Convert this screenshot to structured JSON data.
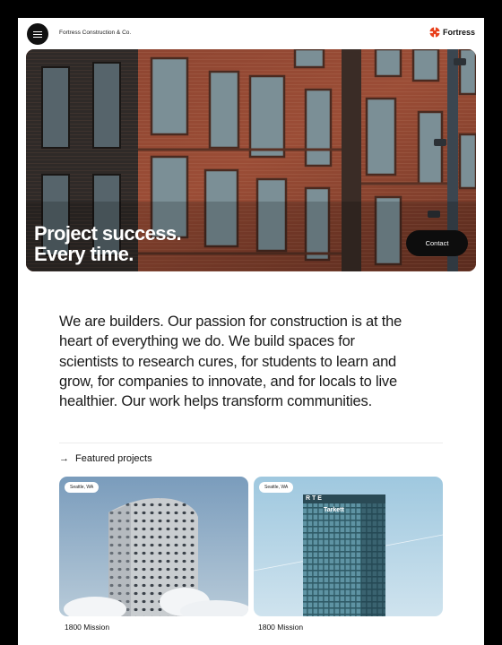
{
  "header": {
    "company_name": "Fortress Construction & Co.",
    "logo_text": "Fortress",
    "accent_color": "#e8401c",
    "menu_icon": "hamburger-menu-icon"
  },
  "hero": {
    "title_line1": "Project success.",
    "title_line2": "Every time.",
    "contact_label": "Contact"
  },
  "intro": {
    "text": "We are builders. Our passion for construction is at the heart of everything we do. We build spaces for scientists to research cures, for students to learn and grow, for companies to innovate, and for locals to live healthier. Our work helps transform communities."
  },
  "featured": {
    "label": "Featured projects",
    "arrow_icon": "arrow-right-icon",
    "projects": [
      {
        "location": "Seattle, WA",
        "title": "1800 Mission"
      },
      {
        "location": "Seattle, WA",
        "title": "1800 Mission"
      }
    ]
  }
}
